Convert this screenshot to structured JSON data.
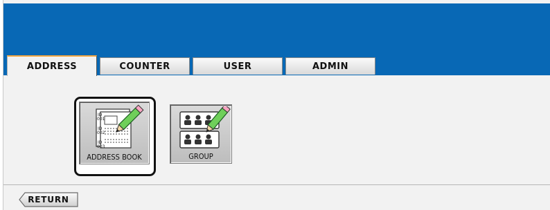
{
  "tabs": [
    {
      "label": "ADDRESS",
      "active": true
    },
    {
      "label": "COUNTER",
      "active": false
    },
    {
      "label": "USER",
      "active": false
    },
    {
      "label": "ADMIN",
      "active": false
    }
  ],
  "main": {
    "buttons": [
      {
        "label": "ADDRESS BOOK",
        "icon": "address-book-icon",
        "selected": true
      },
      {
        "label": "GROUP",
        "icon": "group-icon",
        "selected": false
      }
    ]
  },
  "footer": {
    "return_label": "RETURN"
  },
  "colors": {
    "header": "#0868b5",
    "active_tab_accent": "#f4a640",
    "panel": "#f2f2f2"
  }
}
